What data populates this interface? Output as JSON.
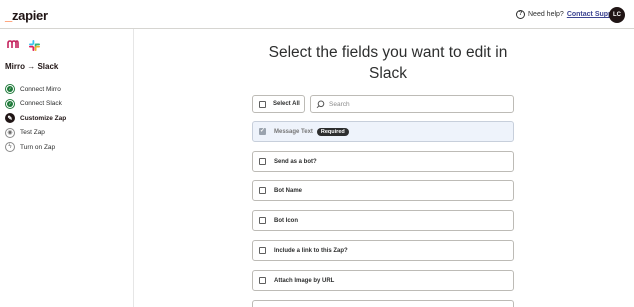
{
  "header": {
    "logo_prefix": "_",
    "logo_text": "zapier",
    "help_text": "Need help?",
    "help_link": "Contact Support",
    "avatar_initials": "LC"
  },
  "sidebar": {
    "zap_title": "Mirro → Slack",
    "steps": [
      {
        "label": "Connect Mirro",
        "state": "done"
      },
      {
        "label": "Connect Slack",
        "state": "done"
      },
      {
        "label": "Customize Zap",
        "state": "current"
      },
      {
        "label": "Test Zap",
        "state": "todo"
      },
      {
        "label": "Turn on Zap",
        "state": "todo"
      }
    ]
  },
  "main": {
    "heading": "Select the fields you want to edit in Slack",
    "select_all_label": "Select All",
    "search_placeholder": "Search",
    "fields": [
      {
        "label": "Message Text",
        "checked": true,
        "badge": "Required"
      },
      {
        "label": "Send as a bot?",
        "checked": false
      },
      {
        "label": "Bot Name",
        "checked": false
      },
      {
        "label": "Bot Icon",
        "checked": false
      },
      {
        "label": "Include a link to this Zap?",
        "checked": false
      },
      {
        "label": "Attach Image by URL",
        "checked": false
      }
    ]
  },
  "colors": {
    "brand_orange": "#ff4f00",
    "done_green": "#1f7a3a",
    "selected_row": "#eef3fb"
  }
}
